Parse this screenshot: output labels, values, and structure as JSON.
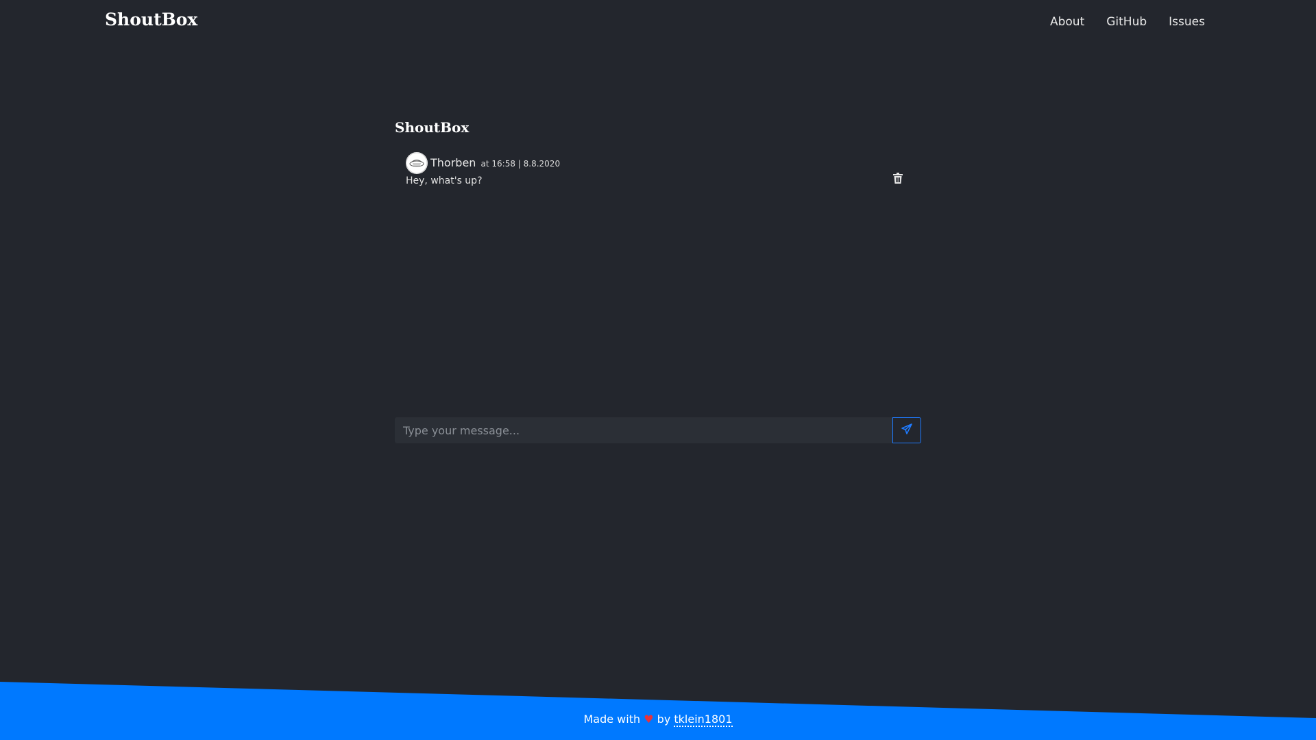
{
  "header": {
    "brand": "ShoutBox",
    "nav": [
      {
        "label": "About"
      },
      {
        "label": "GitHub"
      },
      {
        "label": "Issues"
      }
    ]
  },
  "main": {
    "title": "ShoutBox",
    "messages": [
      {
        "author": "Thorben",
        "meta": "at 16:58 | 8.8.2020",
        "text": "Hey, what's up?",
        "delete_icon": "trash-icon"
      }
    ],
    "input": {
      "placeholder": "Type your message...",
      "value": ""
    },
    "send_icon": "paper-plane-icon"
  },
  "footer": {
    "prefix": "Made with",
    "heart": "♥",
    "by": "by",
    "link": "tklein1801"
  },
  "colors": {
    "background": "#23262d",
    "accent": "#0079ff",
    "heart": "#e8323c",
    "input_bg": "#2b2f36"
  }
}
